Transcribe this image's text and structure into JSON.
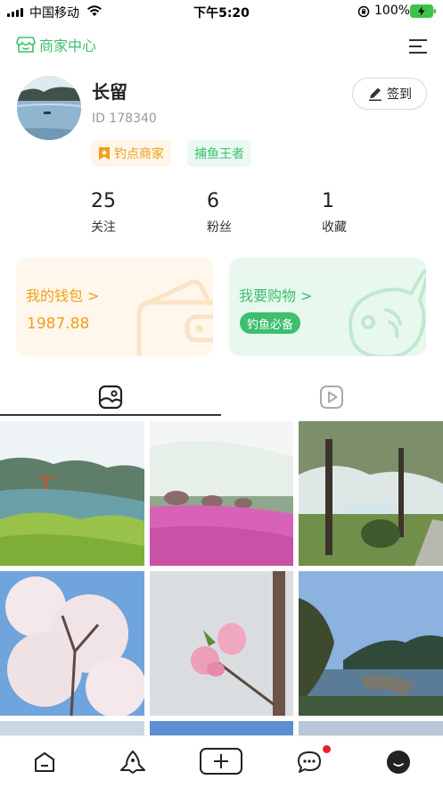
{
  "status_bar": {
    "carrier": "中国移动",
    "time": "下午5:20",
    "battery_pct": "100%"
  },
  "top_nav": {
    "merchant_center": "商家中心",
    "menu_icon": "menu-icon"
  },
  "profile": {
    "name": "长留",
    "id_text": "ID 178340",
    "checkin_label": "签到",
    "tags": [
      "钓点商家",
      "捕鱼王者"
    ]
  },
  "stats": [
    {
      "value": "25",
      "label": "关注"
    },
    {
      "value": "6",
      "label": "粉丝"
    },
    {
      "value": "1",
      "label": "收藏"
    }
  ],
  "cards": {
    "wallet": {
      "title": "我的钱包",
      "amount": "1987.88",
      "arrow": ">"
    },
    "shop": {
      "title": "我要购物",
      "arrow": ">",
      "badge": "钓鱼必备"
    }
  },
  "tabs": {
    "active": "photos",
    "items": [
      "photos-icon",
      "video-icon"
    ]
  },
  "grid": {
    "tiles": [
      "lake-hills-scene",
      "pink-flower-field",
      "park-trees-path",
      "cherry-blossom-tree",
      "peach-blossom-branch",
      "mountain-lake-scene"
    ]
  },
  "bottom_nav": {
    "items": [
      "home-icon",
      "fish-icon",
      "add-icon",
      "message-icon",
      "profile-icon"
    ],
    "message_has_dot": true
  },
  "colors": {
    "green": "#3cbf6e",
    "orange": "#f29d1c",
    "red_dot": "#e8202a"
  }
}
